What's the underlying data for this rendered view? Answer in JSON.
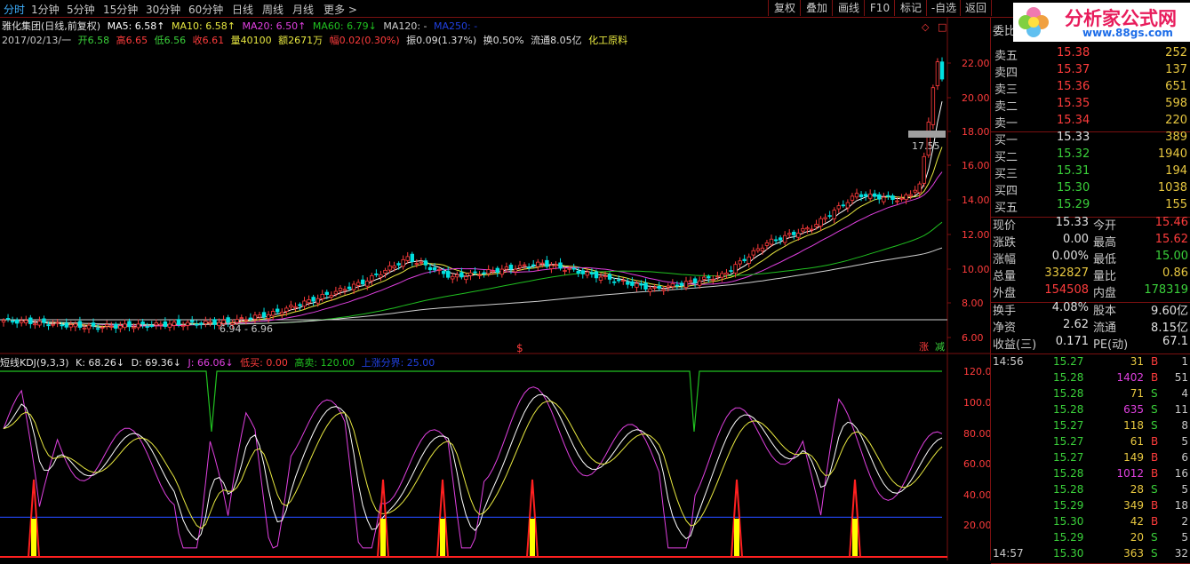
{
  "toolbar": {
    "periods": [
      "分时",
      "1分钟",
      "5分钟",
      "15分钟",
      "30分钟",
      "60分钟",
      "日线",
      "周线",
      "月线",
      "更多 >"
    ],
    "active_period": "日线",
    "buttons": [
      "复权",
      "叠加",
      "画线",
      "F10",
      "标记",
      "-自选",
      "返回"
    ]
  },
  "stock_header": {
    "name": "雅化集团(日线,前复权)",
    "ma5": "MA5: 6.58↑",
    "ma10": "MA10: 6.58↑",
    "ma20": "MA20: 6.50↑",
    "ma60": "MA60: 6.79↓",
    "ma120": "MA120: -",
    "ma250": "MA250: -",
    "date": "2017/02/13/一",
    "open": "开6.58",
    "high": "高6.65",
    "low": "低6.56",
    "close": "收6.61",
    "volume": "量40100",
    "amount": "额2671万",
    "change": "幅0.02(0.30%)",
    "amplitude": "振0.09(1.37%)",
    "turnover": "换0.50%",
    "float_cap": "流通8.05亿",
    "industry": "化工原料"
  },
  "main_axis": [
    "22.00",
    "20.00",
    "18.00",
    "16.00",
    "14.00",
    "12.00",
    "10.00",
    "8.00",
    "6.00"
  ],
  "price_marker": "17.55",
  "low_range_label": "6.94 - 6.96",
  "zhang_label": "涨",
  "jian_label": "减",
  "indicator": {
    "name": "短线KDJ(9,3,3)",
    "k": "K: 68.26↓",
    "d": "D: 69.36↓",
    "j": "J: 66.06↓",
    "low_buy": "低买: 0.00",
    "high_sell": "高卖: 120.00",
    "boundary": "上涨分界: 25.00",
    "axis": [
      "120.00",
      "100.00",
      "80.00",
      "60.00",
      "40.00",
      "20.00"
    ]
  },
  "logo": {
    "text": "分析家公式网",
    "url": "www.88gs.com"
  },
  "order_book": {
    "sells": [
      {
        "label": "卖五",
        "price": "15.38",
        "vol": "252"
      },
      {
        "label": "卖四",
        "price": "15.37",
        "vol": "137"
      },
      {
        "label": "卖三",
        "price": "15.36",
        "vol": "651"
      },
      {
        "label": "卖二",
        "price": "15.35",
        "vol": "598"
      },
      {
        "label": "卖一",
        "price": "15.34",
        "vol": "220"
      }
    ],
    "buys": [
      {
        "label": "买一",
        "price": "15.33",
        "vol": "389"
      },
      {
        "label": "买二",
        "price": "15.32",
        "vol": "1940"
      },
      {
        "label": "买三",
        "price": "15.31",
        "vol": "194"
      },
      {
        "label": "买四",
        "price": "15.30",
        "vol": "1038"
      },
      {
        "label": "买五",
        "price": "15.29",
        "vol": "155"
      }
    ],
    "weibi_label": "委比"
  },
  "stats": [
    {
      "l1": "现价",
      "v1": "15.33",
      "l2": "今开",
      "v2": "15.46"
    },
    {
      "l1": "涨跌",
      "v1": "0.00",
      "l2": "最高",
      "v2": "15.62"
    },
    {
      "l1": "涨幅",
      "v1": "0.00%",
      "l2": "最低",
      "v2": "15.00"
    },
    {
      "l1": "总量",
      "v1": "332827",
      "l2": "量比",
      "v2": "0.86"
    },
    {
      "l1": "外盘",
      "v1": "154508",
      "l2": "内盘",
      "v2": "178319"
    }
  ],
  "stats2": [
    {
      "l1": "换手",
      "v1": "4.08%",
      "l2": "股本",
      "v2": "9.60亿"
    },
    {
      "l1": "净资",
      "v1": "2.62",
      "l2": "流通",
      "v2": "8.15亿"
    },
    {
      "l1": "收益(三)",
      "v1": "0.171",
      "l2": "PE(动)",
      "v2": "67.1"
    }
  ],
  "ticks": [
    {
      "t": "14:56",
      "p": "15.27",
      "v": "31",
      "bs": "B",
      "n": "1"
    },
    {
      "t": "",
      "p": "15.28",
      "v": "1402",
      "bs": "B",
      "n": "51"
    },
    {
      "t": "",
      "p": "15.28",
      "v": "71",
      "bs": "S",
      "n": "4"
    },
    {
      "t": "",
      "p": "15.28",
      "v": "635",
      "bs": "S",
      "n": "11"
    },
    {
      "t": "",
      "p": "15.27",
      "v": "118",
      "bs": "S",
      "n": "8"
    },
    {
      "t": "",
      "p": "15.27",
      "v": "61",
      "bs": "B",
      "n": "5"
    },
    {
      "t": "",
      "p": "15.27",
      "v": "149",
      "bs": "B",
      "n": "6"
    },
    {
      "t": "",
      "p": "15.28",
      "v": "1012",
      "bs": "B",
      "n": "16"
    },
    {
      "t": "",
      "p": "15.28",
      "v": "28",
      "bs": "S",
      "n": "5"
    },
    {
      "t": "",
      "p": "15.29",
      "v": "349",
      "bs": "B",
      "n": "18"
    },
    {
      "t": "",
      "p": "15.30",
      "v": "42",
      "bs": "B",
      "n": "2"
    },
    {
      "t": "",
      "p": "15.29",
      "v": "20",
      "bs": "S",
      "n": "5"
    },
    {
      "t": "14:57",
      "p": "15.30",
      "v": "363",
      "bs": "S",
      "n": "32"
    }
  ],
  "colors": {
    "up": "#ff3c3c",
    "down": "#00e0e0",
    "ma5": "#ffffff",
    "ma10": "#e8e840",
    "ma20": "#e040e0",
    "ma60": "#20c020",
    "ma120": "#d0d0d0",
    "frame": "#7a1010"
  }
}
